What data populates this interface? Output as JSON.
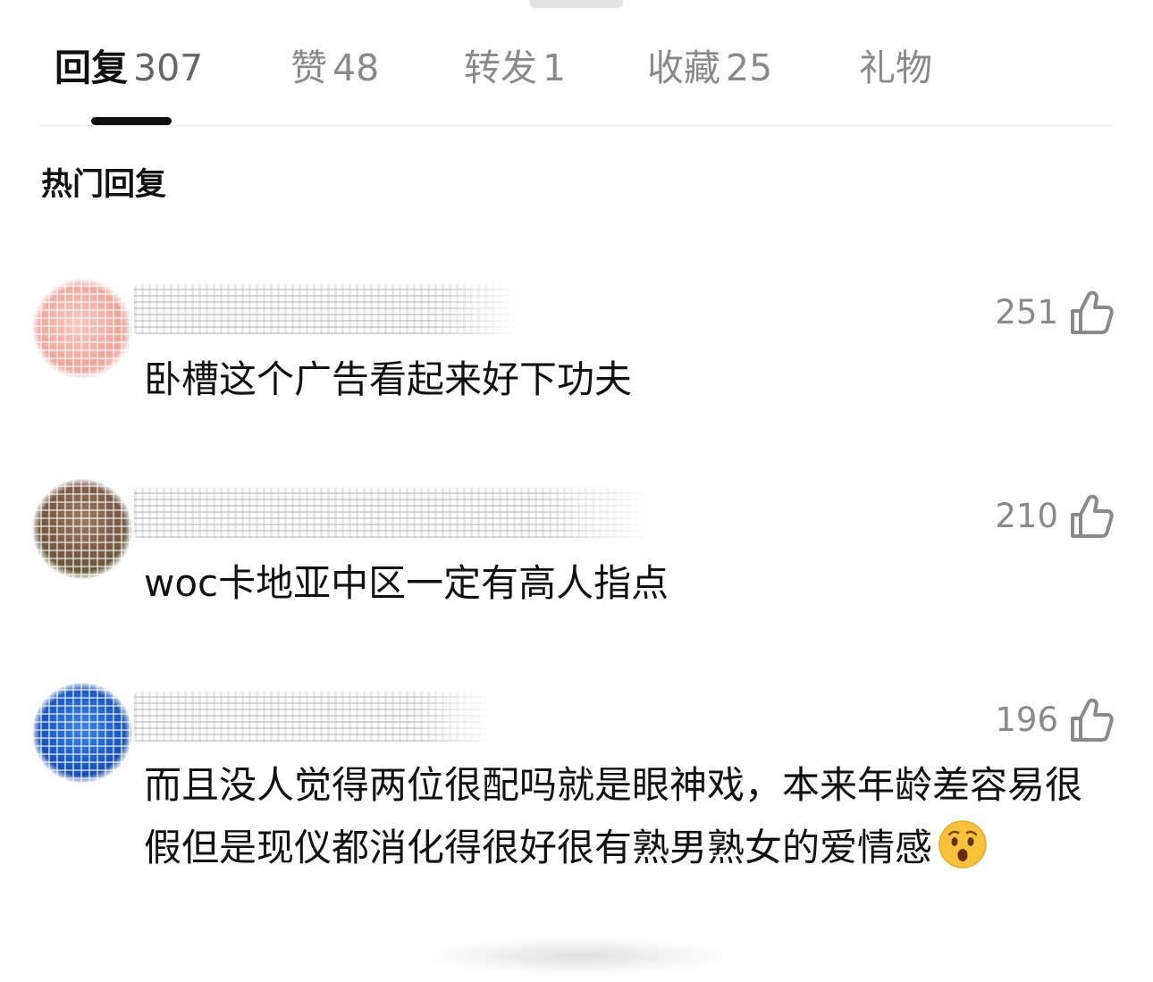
{
  "tabs": [
    {
      "label": "回复",
      "count": "307",
      "active": true
    },
    {
      "label": "赞",
      "count": "48",
      "active": false
    },
    {
      "label": "转发",
      "count": "1",
      "active": false
    },
    {
      "label": "收藏",
      "count": "25",
      "active": false
    },
    {
      "label": "礼物",
      "count": "",
      "active": false
    }
  ],
  "section_title": "热门回复",
  "comments": [
    {
      "likes": "251",
      "text": "卧槽这个广告看起来好下功夫",
      "avatar_colors": [
        "#f7c7be",
        "#f0a79c"
      ]
    },
    {
      "likes": "210",
      "text": "woc卡地亚中区一定有高人指点",
      "avatar_colors": [
        "#8a6a4f",
        "#4f5a2e"
      ]
    },
    {
      "likes": "196",
      "text": "而且没人觉得两位很配吗就是眼神戏，本来年龄差容易很假但是现仪都消化得很好很有熟男熟女的爱情感",
      "emoji": "hushed-face",
      "avatar_colors": [
        "#1d5fc7",
        "#0b2f7a"
      ]
    }
  ],
  "colors": {
    "tab_inactive": "#8a8a8a",
    "tab_active": "#111111",
    "like_icon": "#8a8a8a",
    "emoji_face": "#f8c23a"
  }
}
